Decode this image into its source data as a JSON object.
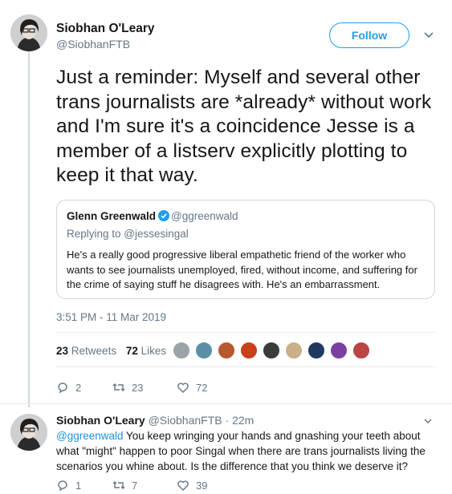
{
  "tweet": {
    "author_name": "Siobhan O'Leary",
    "author_handle": "@SiobhanFTB",
    "follow_label": "Follow",
    "text": "Just a reminder: Myself and several other trans journalists are *already* without work and I'm sure it's a coincidence Jesse is a member of a listserv explicitly plotting to keep it that way.",
    "timestamp": "3:51 PM - 11 Mar 2019",
    "retweets_count": "23",
    "retweets_label": "Retweets",
    "likes_count": "72",
    "likes_label": "Likes",
    "actions": {
      "replies": "2",
      "retweets": "23",
      "likes": "72"
    }
  },
  "quote": {
    "author_name": "Glenn Greenwald",
    "author_handle": "@ggreenwald",
    "replying_to": "Replying to @jessesingal",
    "text": "He's a really good progressive liberal empathetic friend of the worker who wants to see journalists unemployed, fired, without income, and suffering for the crime of saying stuff he disagrees with. He's an embarrassment."
  },
  "reply": {
    "author_name": "Siobhan O'Leary",
    "author_handle": "@SiobhanFTB",
    "time": "· 22m",
    "mention": "@ggreenwald",
    "text": " You keep wringing your hands and gnashing your teeth about what \"might\" happen to poor Singal when there are trans journalists living the scenarios you whine about. Is the difference that you think we deserve it?",
    "actions": {
      "replies": "1",
      "retweets": "7",
      "likes": "39"
    }
  },
  "colors": {
    "accent": "#1da1f2",
    "secondary_text": "#657786",
    "border": "#e6ecf0"
  },
  "icons": [
    "chevron-down-icon",
    "verified-badge-icon",
    "reply-icon",
    "retweet-icon",
    "heart-icon"
  ]
}
